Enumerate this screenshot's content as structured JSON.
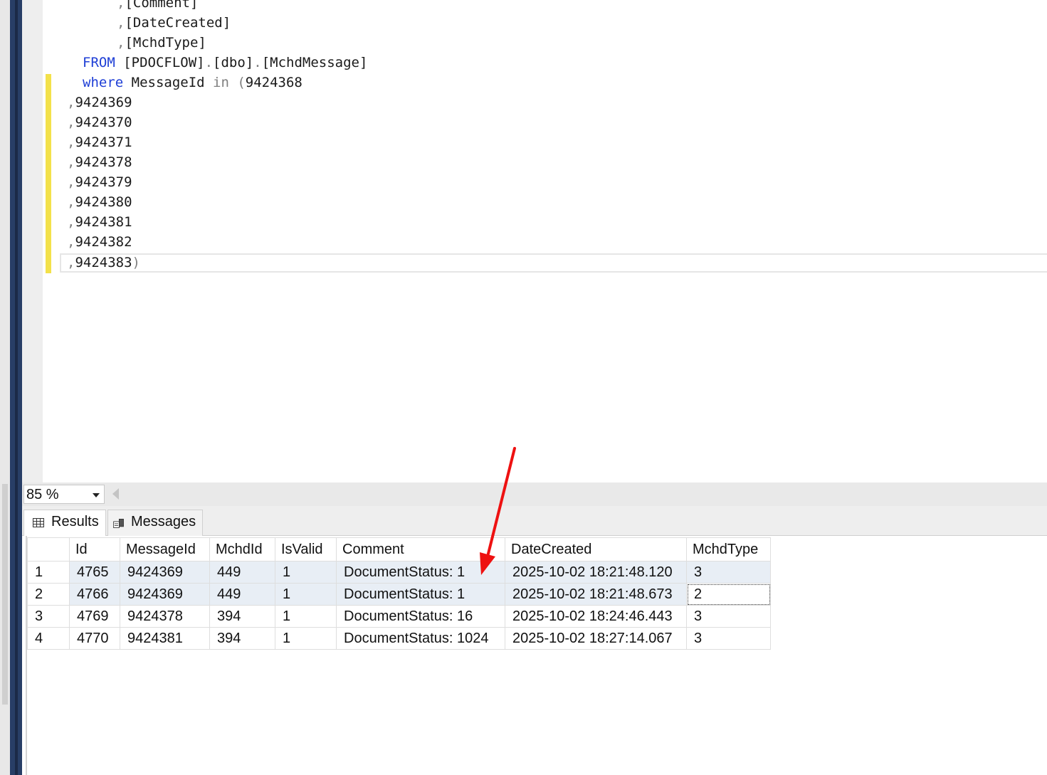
{
  "editor": {
    "lines": [
      {
        "indent": "    ",
        "parts": [
          {
            "t": ",",
            "c": "gr"
          },
          {
            "t": "[Comment]",
            "c": ""
          }
        ]
      },
      {
        "indent": "    ",
        "parts": [
          {
            "t": ",",
            "c": "gr"
          },
          {
            "t": "[DateCreated]",
            "c": ""
          }
        ]
      },
      {
        "indent": "    ",
        "parts": [
          {
            "t": ",",
            "c": "gr"
          },
          {
            "t": "[MchdType]",
            "c": ""
          }
        ]
      },
      {
        "indent": "",
        "parts": [
          {
            "t": "FROM ",
            "c": "kw"
          },
          {
            "t": "[PDOCFLOW]",
            "c": ""
          },
          {
            "t": ".",
            "c": "gr"
          },
          {
            "t": "[dbo]",
            "c": ""
          },
          {
            "t": ".",
            "c": "gr"
          },
          {
            "t": "[MchdMessage]",
            "c": ""
          }
        ]
      },
      {
        "indent": "",
        "parts": [
          {
            "t": "where ",
            "c": "kw"
          },
          {
            "t": "MessageId ",
            "c": ""
          },
          {
            "t": "in (",
            "c": "gr"
          },
          {
            "t": "9424368",
            "c": ""
          }
        ]
      },
      {
        "indent": "",
        "parts": [
          {
            "t": ",",
            "c": "gr"
          },
          {
            "t": "9424369",
            "c": ""
          }
        ]
      },
      {
        "indent": "",
        "parts": [
          {
            "t": ",",
            "c": "gr"
          },
          {
            "t": "9424370",
            "c": ""
          }
        ]
      },
      {
        "indent": "",
        "parts": [
          {
            "t": ",",
            "c": "gr"
          },
          {
            "t": "9424371",
            "c": ""
          }
        ]
      },
      {
        "indent": "",
        "parts": [
          {
            "t": ",",
            "c": "gr"
          },
          {
            "t": "9424378",
            "c": ""
          }
        ]
      },
      {
        "indent": "",
        "parts": [
          {
            "t": ",",
            "c": "gr"
          },
          {
            "t": "9424379",
            "c": ""
          }
        ]
      },
      {
        "indent": "",
        "parts": [
          {
            "t": ",",
            "c": "gr"
          },
          {
            "t": "9424380",
            "c": ""
          }
        ]
      },
      {
        "indent": "",
        "parts": [
          {
            "t": ",",
            "c": "gr"
          },
          {
            "t": "9424381",
            "c": ""
          }
        ]
      },
      {
        "indent": "",
        "parts": [
          {
            "t": ",",
            "c": "gr"
          },
          {
            "t": "9424382",
            "c": ""
          }
        ]
      },
      {
        "indent": "",
        "parts": [
          {
            "t": ",",
            "c": "gr"
          },
          {
            "t": "9424383",
            "c": ""
          },
          {
            "t": ")",
            "c": "gr"
          }
        ]
      }
    ]
  },
  "zoom": {
    "value": "85 %"
  },
  "tabs": {
    "results": "Results",
    "messages": "Messages"
  },
  "grid": {
    "columns": [
      "",
      "Id",
      "MessageId",
      "MchdId",
      "IsValid",
      "Comment",
      "DateCreated",
      "MchdType"
    ],
    "rows": [
      [
        "1",
        "4765",
        "9424369",
        "449",
        "1",
        "DocumentStatus: 1",
        "2025-10-02 18:21:48.120",
        "3"
      ],
      [
        "2",
        "4766",
        "9424369",
        "449",
        "1",
        "DocumentStatus: 1",
        "2025-10-02 18:21:48.673",
        "2"
      ],
      [
        "3",
        "4769",
        "9424378",
        "394",
        "1",
        "DocumentStatus: 16",
        "2025-10-02 18:24:46.443",
        "3"
      ],
      [
        "4",
        "4770",
        "9424381",
        "394",
        "1",
        "DocumentStatus: 1024",
        "2025-10-02 18:27:14.067",
        "3"
      ]
    ]
  },
  "colors": {
    "keyword": "#1f3fd6",
    "annotation_arrow": "#ee1111",
    "selected_row": "#e8eef5"
  }
}
